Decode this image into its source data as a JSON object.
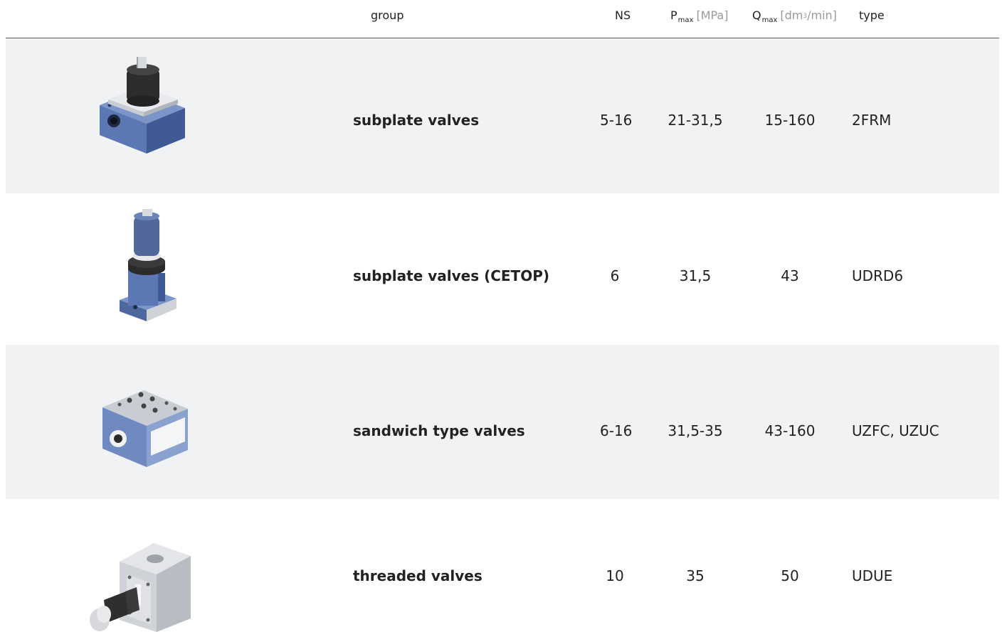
{
  "header": {
    "group": "group",
    "ns": "NS",
    "p_symbol": "P",
    "p_sub": "max",
    "p_unit": "[MPa]",
    "q_symbol": "Q",
    "q_sub": "max",
    "q_unit_pre": "[dm",
    "q_unit_sup": "3",
    "q_unit_post": "/min]",
    "type": "type"
  },
  "rows": [
    {
      "group": "subplate valves",
      "ns": "5-16",
      "p": "21-31,5",
      "q": "15-160",
      "type": "2FRM",
      "icon": "subplate-valve-image"
    },
    {
      "group": "subplate valves (CETOP)",
      "ns": "6",
      "p": "31,5",
      "q": "43",
      "type": "UDRD6",
      "icon": "cetop-valve-image"
    },
    {
      "group": "sandwich type valves",
      "ns": "6-16",
      "p": "31,5-35",
      "q": "43-160",
      "type": "UZFC, UZUC",
      "icon": "sandwich-valve-image"
    },
    {
      "group": "threaded valves",
      "ns": "10",
      "p": "35",
      "q": "50",
      "type": "UDUE",
      "icon": "threaded-valve-image"
    }
  ],
  "colors": {
    "row_shade": "#f1f2f4",
    "valve_blue": "#5b77b4",
    "valve_dark": "#2b2b2b",
    "valve_silver": "#cfd2d6",
    "header_rule": "#5a5a5a",
    "unit_gray": "#9a9a9a"
  }
}
